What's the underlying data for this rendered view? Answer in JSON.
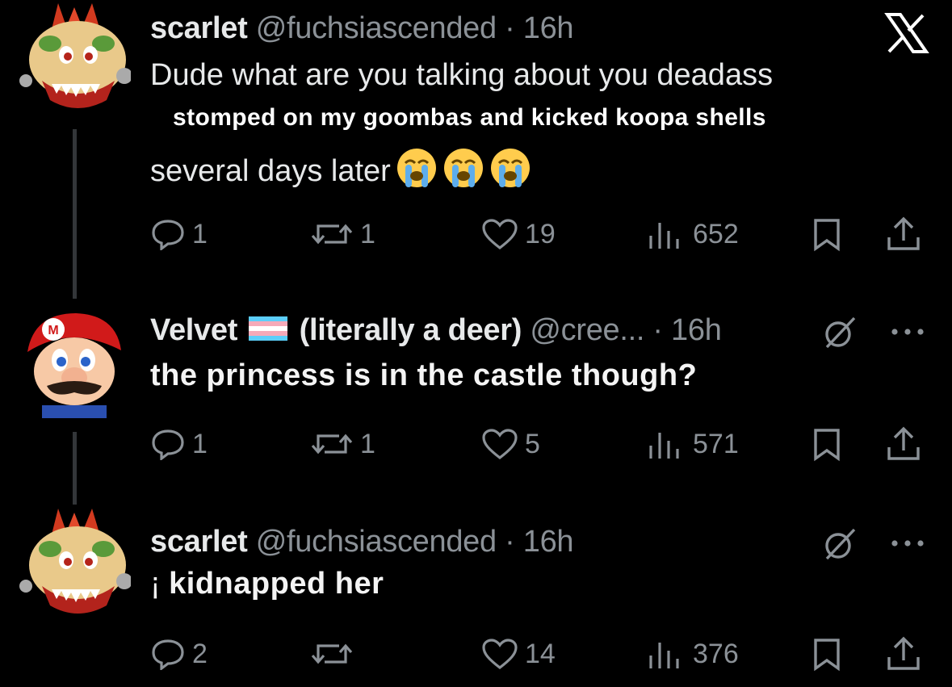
{
  "app": {
    "logo": "x-logo-icon"
  },
  "tweets": [
    {
      "display_name": "scarlet",
      "handle": "@fuchsiascended",
      "separator": "·",
      "time": "16h",
      "avatar": "bowser-avatar",
      "text_line1": "Dude what are you talking about you deadass",
      "caption_overlay": "stomped on my goombas and kicked koopa shells",
      "text_line3": "several days later",
      "emojis": [
        "loudly-crying-face",
        "loudly-crying-face",
        "loudly-crying-face"
      ],
      "stats": {
        "replies": "1",
        "reposts": "1",
        "likes": "19",
        "views": "652"
      }
    },
    {
      "display_name": "Velvet",
      "name_suffix": "(literally a deer)",
      "flag": "transgender-flag",
      "handle": "@cree...",
      "separator": "·",
      "time": "16h",
      "avatar": "mario-avatar",
      "text": "the princess is in the castle though?",
      "stats": {
        "replies": "1",
        "reposts": "1",
        "likes": "5",
        "views": "571"
      }
    },
    {
      "display_name": "scarlet",
      "handle": "@fuchsiascended",
      "separator": "·",
      "time": "16h",
      "avatar": "bowser-avatar",
      "text_prefix": "¡",
      "text": "kidnapped her",
      "stats": {
        "replies": "2",
        "reposts": "",
        "likes": "14",
        "views": "376"
      }
    }
  ],
  "colors": {
    "background": "#000000",
    "text": "#e7e9ea",
    "muted": "#8b9197",
    "thread_line": "#333639"
  }
}
